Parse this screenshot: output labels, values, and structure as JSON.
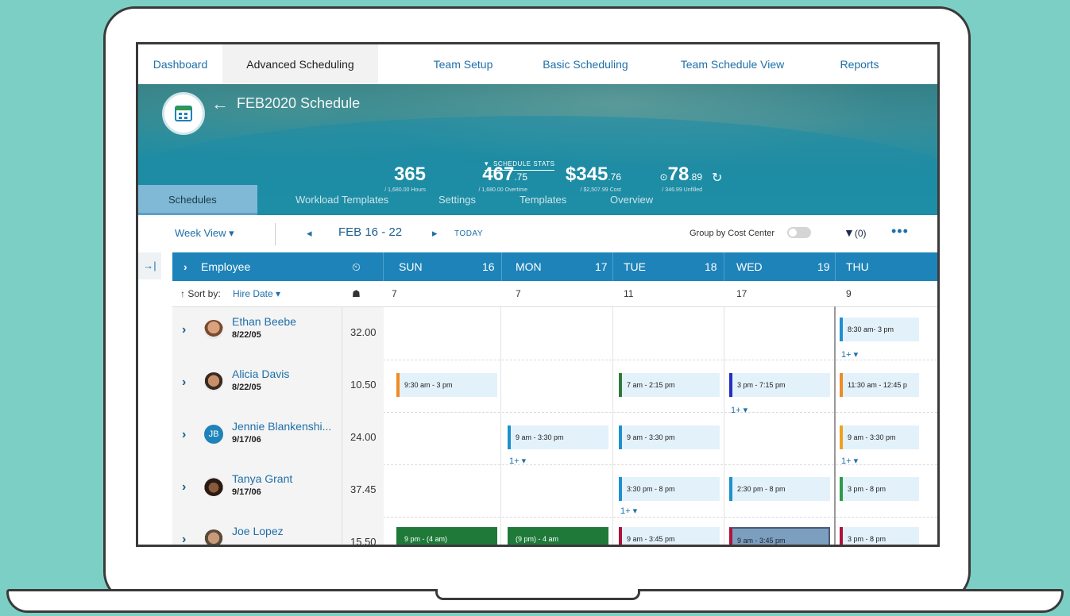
{
  "topnav": {
    "tabs": [
      "Dashboard",
      "Advanced Scheduling",
      "Team Setup",
      "Basic Scheduling",
      "Team Schedule View",
      "Reports"
    ],
    "active": "Advanced Scheduling"
  },
  "banner": {
    "back_arrow": "←",
    "title": "FEB2020 Schedule",
    "stats_toggle": "SCHEDULE STATS",
    "stats": [
      {
        "big": "365",
        "small": "",
        "sub": "/ 1,680.00 Hours"
      },
      {
        "big": "467",
        "small": ".75",
        "sub": "/ 1,680.00 Overtime"
      },
      {
        "big": "$345",
        "small": ".76",
        "sub": "/ $2,507.99 Cost"
      },
      {
        "big": "78",
        "small": ".89",
        "sub": "/ 346.99 Unfilled",
        "prefix": "⊙"
      }
    ]
  },
  "subtabs": [
    "Schedules",
    "Workload Templates",
    "Settings",
    "Templates",
    "Overview"
  ],
  "toolbar": {
    "view": "Week View ▾",
    "prev": "◂",
    "date_range": "FEB 16 - 22",
    "next": "▸",
    "today": "TODAY",
    "group_by": "Group by Cost Center",
    "filter": "(0)",
    "more": "•••"
  },
  "grid": {
    "collapse": "→|",
    "employee_header": "Employee",
    "days": [
      {
        "day": "SUN",
        "num": "16",
        "count": "7"
      },
      {
        "day": "MON",
        "num": "17",
        "count": "7"
      },
      {
        "day": "TUE",
        "num": "18",
        "count": "11"
      },
      {
        "day": "WED",
        "num": "19",
        "count": "17"
      },
      {
        "day": "THU",
        "num": "",
        "count": "9"
      }
    ],
    "sort_label": "↑ Sort by:",
    "sort_value": "Hire Date ▾"
  },
  "employees": [
    {
      "name": "Ethan Beebe",
      "date": "8/22/05",
      "hours": "32.00"
    },
    {
      "name": "Alicia Davis",
      "date": "8/22/05",
      "hours": "10.50"
    },
    {
      "name": "Jennie Blankenshi...",
      "date": "9/17/06",
      "hours": "24.00",
      "initials": "JB"
    },
    {
      "name": "Tanya Grant",
      "date": "9/17/06",
      "hours": "37.45"
    },
    {
      "name": "Joe Lopez",
      "date": "",
      "hours": "15.50"
    }
  ],
  "shifts": {
    "ethan_thu": "8:30 am- 3 pm",
    "alicia_sun": "9:30 am - 3 pm",
    "alicia_tue": "7 am - 2:15 pm",
    "alicia_wed": "3 pm - 7:15 pm",
    "alicia_thu": "11:30 am - 12:45 p",
    "jennie_mon": "9 am - 3:30 pm",
    "jennie_tue": "9 am - 3:30 pm",
    "jennie_thu": "9 am - 3:30 pm",
    "tanya_tue": "3:30 pm - 8 pm",
    "tanya_wed": "2:30 pm - 8 pm",
    "tanya_thu": "3 pm - 8 pm",
    "joe_sun": "9 pm - (4 am)",
    "joe_mon": "(9 pm) - 4 am",
    "joe_tue": "9 am - 3:45 pm",
    "joe_wed": "9 am - 3:45 pm",
    "joe_thu": "3 pm - 8 pm",
    "more": "1+ ▾"
  },
  "colors": {
    "nav_link": "#1e6fa8",
    "header_blue": "#1e83b9",
    "shift_bg": "#e3f1fb",
    "orange": "#f08a24",
    "green": "#2e9a4a",
    "dark_green": "#1f7a3a",
    "navy": "#2430c0",
    "crimson": "#b0123a",
    "teal_blue": "#1e90d0"
  }
}
